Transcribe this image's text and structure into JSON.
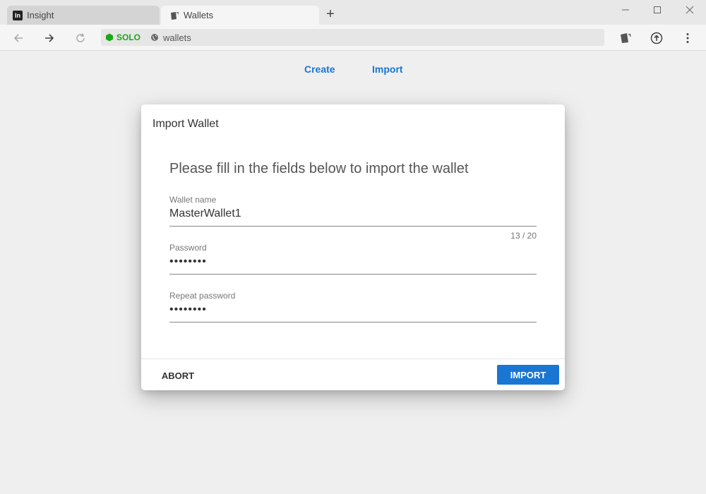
{
  "browser": {
    "tabs": [
      {
        "label": "Insight",
        "active": false,
        "icon": "insight-logo-icon",
        "icon_text": "In"
      },
      {
        "label": "Wallets",
        "active": true,
        "icon": "wallet-icon"
      }
    ],
    "new_tab": "+",
    "window_controls": [
      "–",
      "☐",
      "✕"
    ],
    "address": {
      "network_badge": "SOLO",
      "url": "wallets"
    },
    "colors": {
      "network_badge": "#1aa81a",
      "accent": "#1976d2"
    }
  },
  "page_nav": {
    "create": "Create",
    "import": "Import"
  },
  "dialog": {
    "title": "Import Wallet",
    "subtitle": "Please fill in the fields below to import the wallet",
    "fields": {
      "wallet_name": {
        "label": "Wallet name",
        "value": "MasterWallet1",
        "counter": "13 / 20"
      },
      "password": {
        "label": "Password",
        "value": "••••••••"
      },
      "repeat_password": {
        "label": "Repeat password",
        "value": "••••••••"
      }
    },
    "actions": {
      "abort": "ABORT",
      "import": "IMPORT"
    }
  }
}
